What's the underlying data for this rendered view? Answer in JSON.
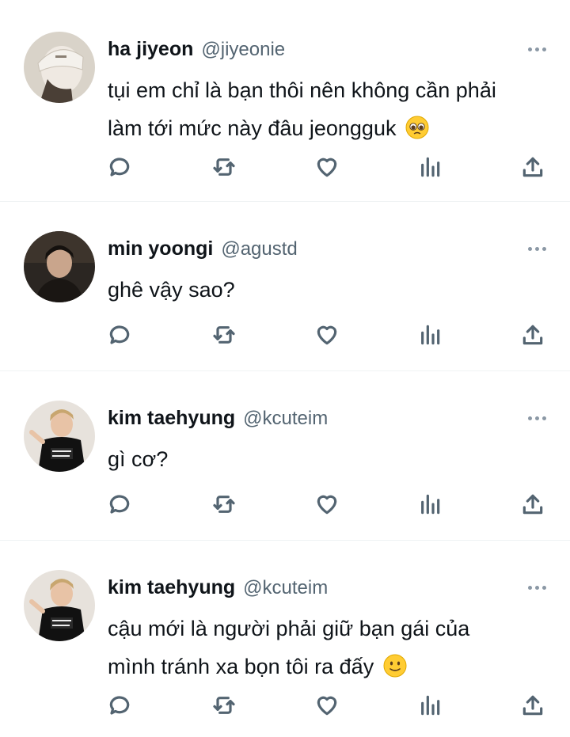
{
  "tweets": [
    {
      "display_name": "ha jiyeon",
      "handle": "@jiyeonie",
      "text_lines": [
        "tụi em chỉ là bạn thôi nên không cần phải",
        "làm tới mức này đâu jeongguk"
      ],
      "emoji": "pleading-face-emoji"
    },
    {
      "display_name": "min yoongi",
      "handle": "@agustd",
      "text_lines": [
        "ghê vậy sao?"
      ],
      "emoji": ""
    },
    {
      "display_name": "kim taehyung",
      "handle": "@kcuteim",
      "text_lines": [
        "gì cơ?"
      ],
      "emoji": ""
    },
    {
      "display_name": "kim taehyung",
      "handle": "@kcuteim",
      "text_lines": [
        "cậu mới là người phải giữ bạn gái của",
        "mình tránh xa bọn tôi ra đấy"
      ],
      "emoji": "slightly-smiling-face-emoji"
    }
  ],
  "actions": [
    "reply-icon",
    "retweet-icon",
    "like-icon",
    "analytics-icon",
    "share-icon"
  ],
  "colors": {
    "text": "#0f1419",
    "secondary": "#536471",
    "divider": "#eff3f4",
    "emoji_yellow": "#ffcc33"
  }
}
